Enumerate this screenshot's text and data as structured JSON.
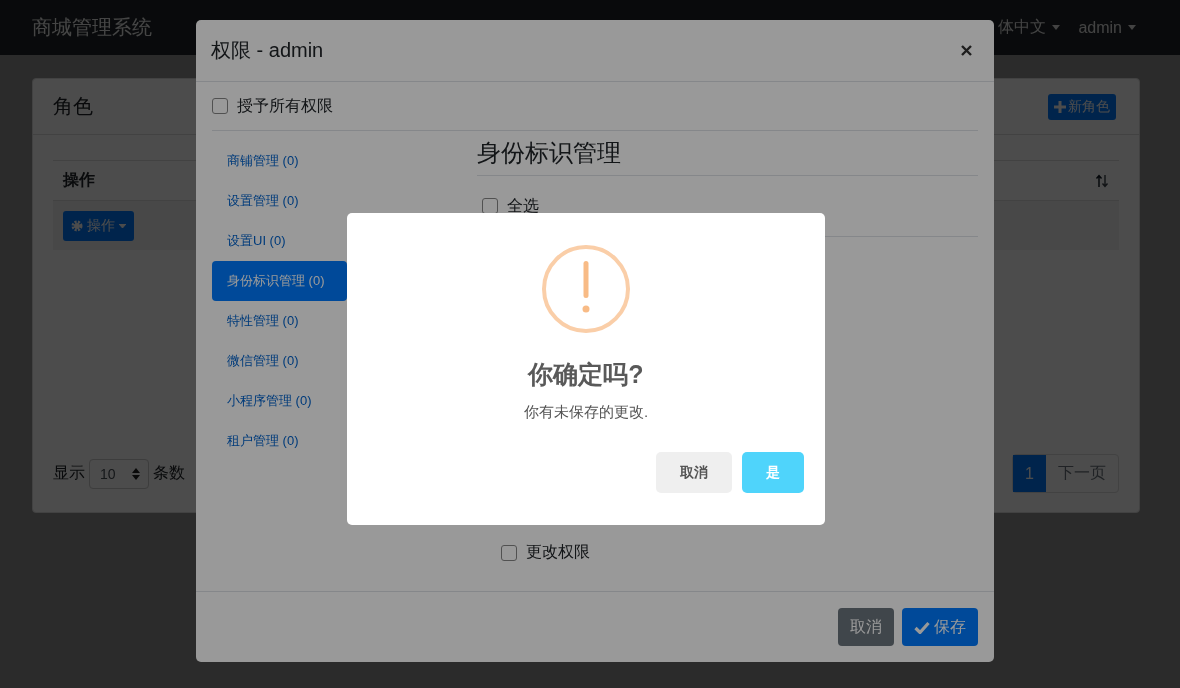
{
  "navbar": {
    "brand": "商城管理系统",
    "language": "体中文",
    "user": "admin"
  },
  "page": {
    "title": "角色",
    "new_button": "新角色",
    "table": {
      "columns": [
        "操作"
      ],
      "rows": [
        {
          "action_button": "操作"
        }
      ]
    },
    "page_size": {
      "label": "显示",
      "value": "10",
      "suffix": "条数"
    },
    "pagination": [
      {
        "label": "1",
        "selected": true
      },
      {
        "label": "下一页",
        "selected": false
      }
    ]
  },
  "modal": {
    "title": "权限 - admin",
    "grant_all": {
      "label": "授予所有权限",
      "checked": false
    },
    "groups": [
      {
        "label": "商铺管理 (0)",
        "selected": false
      },
      {
        "label": "设置管理 (0)",
        "selected": false
      },
      {
        "label": "设置UI (0)",
        "selected": false
      },
      {
        "label": "身份标识管理 (0)",
        "selected": true
      },
      {
        "label": "特性管理 (0)",
        "selected": false
      },
      {
        "label": "微信管理 (0)",
        "selected": false
      },
      {
        "label": "小程序管理 (0)",
        "selected": false
      },
      {
        "label": "租户管理 (0)",
        "selected": false
      }
    ],
    "section_title": "身份标识管理",
    "permissions": [
      {
        "label": "全选",
        "checked": false,
        "kind": "select_all"
      },
      {
        "label": "更改权限",
        "checked": false,
        "kind": "item"
      }
    ],
    "buttons": [
      {
        "label": "取消",
        "kind": "secondary"
      },
      {
        "label": "保存",
        "kind": "primary"
      }
    ]
  },
  "alert": {
    "title": "你确定吗?",
    "message": "你有未保存的更改.",
    "buttons": [
      {
        "label": "取消",
        "kind": "cancel"
      },
      {
        "label": "是",
        "kind": "confirm"
      }
    ]
  }
}
